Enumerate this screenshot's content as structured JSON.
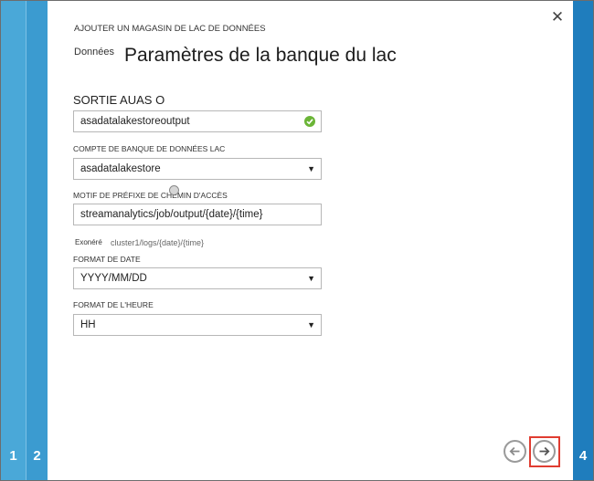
{
  "wizard": {
    "subtitle": "AJOUTER UN MAGASIN DE LAC DE DONNÉES",
    "title_prefix": "Données",
    "title": "Paramètres de la banque du lac"
  },
  "steps": {
    "step1": "1",
    "step2": "2",
    "step4": "4"
  },
  "form": {
    "section_label": "SORTIE AUAS O",
    "output_name": {
      "value": "asadatalakestoreoutput",
      "status": "valid"
    },
    "account": {
      "label": "COMPTE DE BANQUE DE DONNÉES LAC",
      "value": "asadatalakestore"
    },
    "path_prefix": {
      "label": "MOTIF DE PRÉFIXE DE CHEMIN D'ACCÈS",
      "value": "streamanalytics/job/output/{date}/{time}"
    },
    "example": {
      "label": "Exonéré",
      "value": "cluster1/logs/{date}/{time}"
    },
    "date_format": {
      "label": "FORMAT DE DATE",
      "value": "YYYY/MM/DD"
    },
    "time_format": {
      "label": "FORMAT DE L'HEURE",
      "value": "HH"
    }
  },
  "icons": {
    "close": "close-icon",
    "valid": "checkmark-circle-icon",
    "dropdown": "chevron-down-icon",
    "back": "arrow-left-icon",
    "next": "arrow-right-icon"
  },
  "colors": {
    "rail_step1": "#4aa8d8",
    "rail_step2": "#3b9bd0",
    "rail_step4": "#1f7dbd",
    "valid_green": "#6bb537",
    "highlight_red": "#e03c31"
  }
}
